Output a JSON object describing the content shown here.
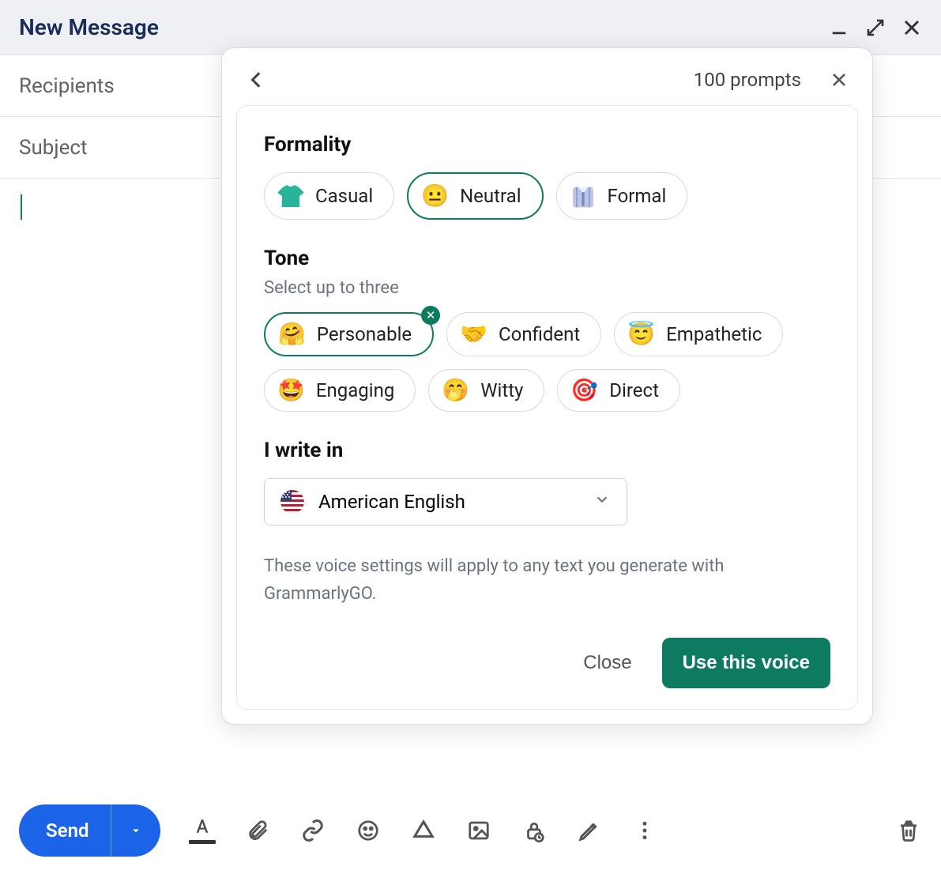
{
  "window": {
    "title": "New Message"
  },
  "fields": {
    "recipients_label": "Recipients",
    "subject_label": "Subject"
  },
  "popup": {
    "prompt_count": "100 prompts",
    "formality": {
      "heading": "Formality",
      "options": [
        {
          "label": "Casual",
          "selected": false,
          "icon": "tshirt"
        },
        {
          "label": "Neutral",
          "selected": true,
          "icon": "neutral-face"
        },
        {
          "label": "Formal",
          "selected": false,
          "icon": "necktie-shirt"
        }
      ]
    },
    "tone": {
      "heading": "Tone",
      "subtitle": "Select up to three",
      "options": [
        {
          "label": "Personable",
          "selected": true,
          "icon": "hug",
          "removable": true
        },
        {
          "label": "Confident",
          "selected": false,
          "icon": "handshake"
        },
        {
          "label": "Empathetic",
          "selected": false,
          "icon": "halo"
        },
        {
          "label": "Engaging",
          "selected": false,
          "icon": "star-eyes"
        },
        {
          "label": "Witty",
          "selected": false,
          "icon": "hand-over-mouth"
        },
        {
          "label": "Direct",
          "selected": false,
          "icon": "target"
        }
      ]
    },
    "language": {
      "heading": "I write in",
      "selected": "American English",
      "flag": "us"
    },
    "note": "These voice settings will apply to any text you generate with GrammarlyGO.",
    "footer": {
      "close": "Close",
      "confirm": "Use this voice"
    }
  },
  "toolbar": {
    "send": "Send"
  }
}
